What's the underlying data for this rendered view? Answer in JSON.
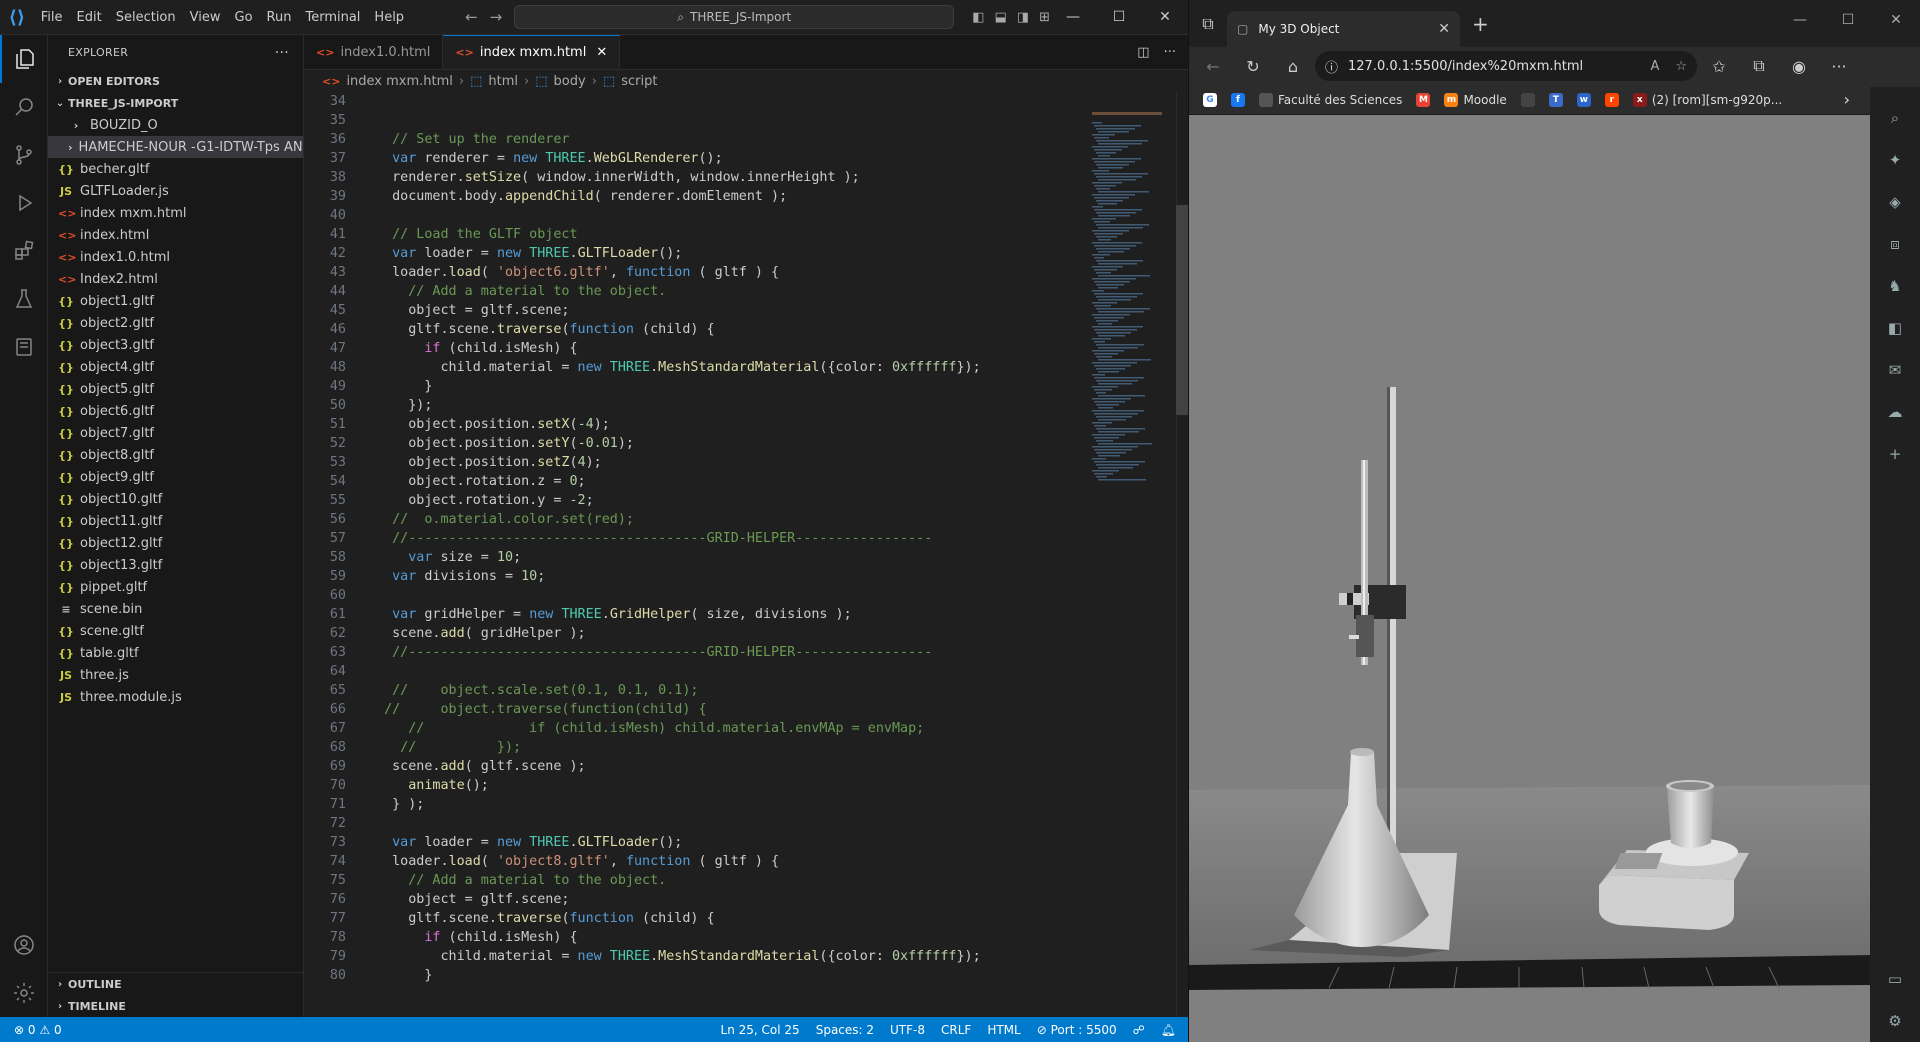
{
  "titlebar": {
    "menu": [
      "File",
      "Edit",
      "Selection",
      "View",
      "Go",
      "Run",
      "Terminal",
      "Help"
    ],
    "search_text": "THREE_JS-Import"
  },
  "explorer": {
    "title": "EXPLORER",
    "more": "···",
    "open_editors": "OPEN EDITORS",
    "project": "THREE_JS-IMPORT",
    "items": [
      {
        "label": "BOUZID_O",
        "type": "folder"
      },
      {
        "label": "HAMECHE-NOUR -G1-IDTW-Tps ANN",
        "type": "folder"
      },
      {
        "label": "becher.gltf",
        "type": "json"
      },
      {
        "label": "GLTFLoader.js",
        "type": "js"
      },
      {
        "label": "index mxm.html",
        "type": "html"
      },
      {
        "label": "index.html",
        "type": "html"
      },
      {
        "label": "index1.0.html",
        "type": "html"
      },
      {
        "label": "Index2.html",
        "type": "html"
      },
      {
        "label": "object1.gltf",
        "type": "json"
      },
      {
        "label": "object2.gltf",
        "type": "json"
      },
      {
        "label": "object3.gltf",
        "type": "json"
      },
      {
        "label": "object4.gltf",
        "type": "json"
      },
      {
        "label": "object5.gltf",
        "type": "json"
      },
      {
        "label": "object6.gltf",
        "type": "json"
      },
      {
        "label": "object7.gltf",
        "type": "json"
      },
      {
        "label": "object8.gltf",
        "type": "json"
      },
      {
        "label": "object9.gltf",
        "type": "json"
      },
      {
        "label": "object10.gltf",
        "type": "json"
      },
      {
        "label": "object11.gltf",
        "type": "json"
      },
      {
        "label": "object12.gltf",
        "type": "json"
      },
      {
        "label": "object13.gltf",
        "type": "json"
      },
      {
        "label": "pippet.gltf",
        "type": "json"
      },
      {
        "label": "scene.bin",
        "type": "bin"
      },
      {
        "label": "scene.gltf",
        "type": "json"
      },
      {
        "label": "table.gltf",
        "type": "json"
      },
      {
        "label": "three.js",
        "type": "js"
      },
      {
        "label": "three.module.js",
        "type": "js"
      }
    ],
    "outline": "OUTLINE",
    "timeline": "TIMELINE"
  },
  "editor": {
    "tabs": [
      {
        "label": "index1.0.html",
        "active": false
      },
      {
        "label": "index mxm.html",
        "active": true
      }
    ],
    "breadcrumb": [
      "index mxm.html",
      "html",
      "body",
      "script"
    ],
    "code_lines": [
      {
        "n": "34",
        "t": ""
      },
      {
        "n": "35",
        "t": ""
      },
      {
        "n": "36",
        "t": "  // Set up the renderer"
      },
      {
        "n": "37",
        "t": "  var renderer = new THREE.WebGLRenderer();"
      },
      {
        "n": "38",
        "t": "  renderer.setSize( window.innerWidth, window.innerHeight );"
      },
      {
        "n": "39",
        "t": "  document.body.appendChild( renderer.domElement );"
      },
      {
        "n": "40",
        "t": ""
      },
      {
        "n": "41",
        "t": "  // Load the GLTF object"
      },
      {
        "n": "42",
        "t": "  var loader = new THREE.GLTFLoader();"
      },
      {
        "n": "43",
        "t": "  loader.load( 'object6.gltf', function ( gltf ) {"
      },
      {
        "n": "44",
        "t": "    // Add a material to the object."
      },
      {
        "n": "45",
        "t": "    object = gltf.scene;"
      },
      {
        "n": "46",
        "t": "    gltf.scene.traverse(function (child) {"
      },
      {
        "n": "47",
        "t": "      if (child.isMesh) {"
      },
      {
        "n": "48",
        "t": "        child.material = new THREE.MeshStandardMaterial({color: 0xffffff});"
      },
      {
        "n": "49",
        "t": "      }"
      },
      {
        "n": "50",
        "t": "    });"
      },
      {
        "n": "51",
        "t": "    object.position.setX(-4);"
      },
      {
        "n": "52",
        "t": "    object.position.setY(-0.01);"
      },
      {
        "n": "53",
        "t": "    object.position.setZ(4);"
      },
      {
        "n": "54",
        "t": "    object.rotation.z = 0;"
      },
      {
        "n": "55",
        "t": "    object.rotation.y = -2;"
      },
      {
        "n": "56",
        "t": "  //  o.material.color.set(red);"
      },
      {
        "n": "57",
        "t": "  //-------------------------------------GRID-HELPER-----------------"
      },
      {
        "n": "58",
        "t": "    var size = 10;"
      },
      {
        "n": "59",
        "t": "  var divisions = 10;"
      },
      {
        "n": "60",
        "t": ""
      },
      {
        "n": "61",
        "t": "  var gridHelper = new THREE.GridHelper( size, divisions );"
      },
      {
        "n": "62",
        "t": "  scene.add( gridHelper );"
      },
      {
        "n": "63",
        "t": "  //-------------------------------------GRID-HELPER-----------------"
      },
      {
        "n": "64",
        "t": ""
      },
      {
        "n": "65",
        "t": "  //    object.scale.set(0.1, 0.1, 0.1);"
      },
      {
        "n": "66",
        "t": " //     object.traverse(function(child) {"
      },
      {
        "n": "67",
        "t": "    //             if (child.isMesh) child.material.envMAp = envMap;"
      },
      {
        "n": "68",
        "t": "   //          });"
      },
      {
        "n": "69",
        "t": "  scene.add( gltf.scene );"
      },
      {
        "n": "70",
        "t": "    animate();"
      },
      {
        "n": "71",
        "t": "  } );"
      },
      {
        "n": "72",
        "t": ""
      },
      {
        "n": "73",
        "t": "  var loader = new THREE.GLTFLoader();"
      },
      {
        "n": "74",
        "t": "  loader.load( 'object8.gltf', function ( gltf ) {"
      },
      {
        "n": "75",
        "t": "    // Add a material to the object."
      },
      {
        "n": "76",
        "t": "    object = gltf.scene;"
      },
      {
        "n": "77",
        "t": "    gltf.scene.traverse(function (child) {"
      },
      {
        "n": "78",
        "t": "      if (child.isMesh) {"
      },
      {
        "n": "79",
        "t": "        child.material = new THREE.MeshStandardMaterial({color: 0xffffff});"
      },
      {
        "n": "80",
        "t": "      }"
      }
    ]
  },
  "statusbar": {
    "errors": "0",
    "warnings": "0",
    "position": "Ln 25, Col 25",
    "spaces": "Spaces: 2",
    "encoding": "UTF-8",
    "eol": "CRLF",
    "language": "HTML",
    "port": "Port : 5500"
  },
  "browser": {
    "tab_title": "My 3D Object",
    "url": "127.0.0.1:5500/index%20mxm.html",
    "favorites": [
      {
        "label": "",
        "color": "#ffffff",
        "icon": "G"
      },
      {
        "label": "",
        "color": "#1877f2",
        "icon": "f"
      },
      {
        "label": "Faculté des Sciences",
        "color": "#555555",
        "icon": "page"
      },
      {
        "label": "",
        "color": "#ea4335",
        "icon": "M"
      },
      {
        "label": "Moodle",
        "color": "#f98012",
        "icon": "m"
      },
      {
        "label": "",
        "color": "#444444",
        "icon": "tv"
      },
      {
        "label": "",
        "color": "#3b6bc9",
        "icon": "T"
      },
      {
        "label": "",
        "color": "#2b65c9",
        "icon": "w"
      },
      {
        "label": "",
        "color": "#ff4500",
        "icon": "r"
      },
      {
        "label": "(2) [rom][sm-g920p...",
        "color": "#8b1a1a",
        "icon": "x"
      }
    ]
  }
}
